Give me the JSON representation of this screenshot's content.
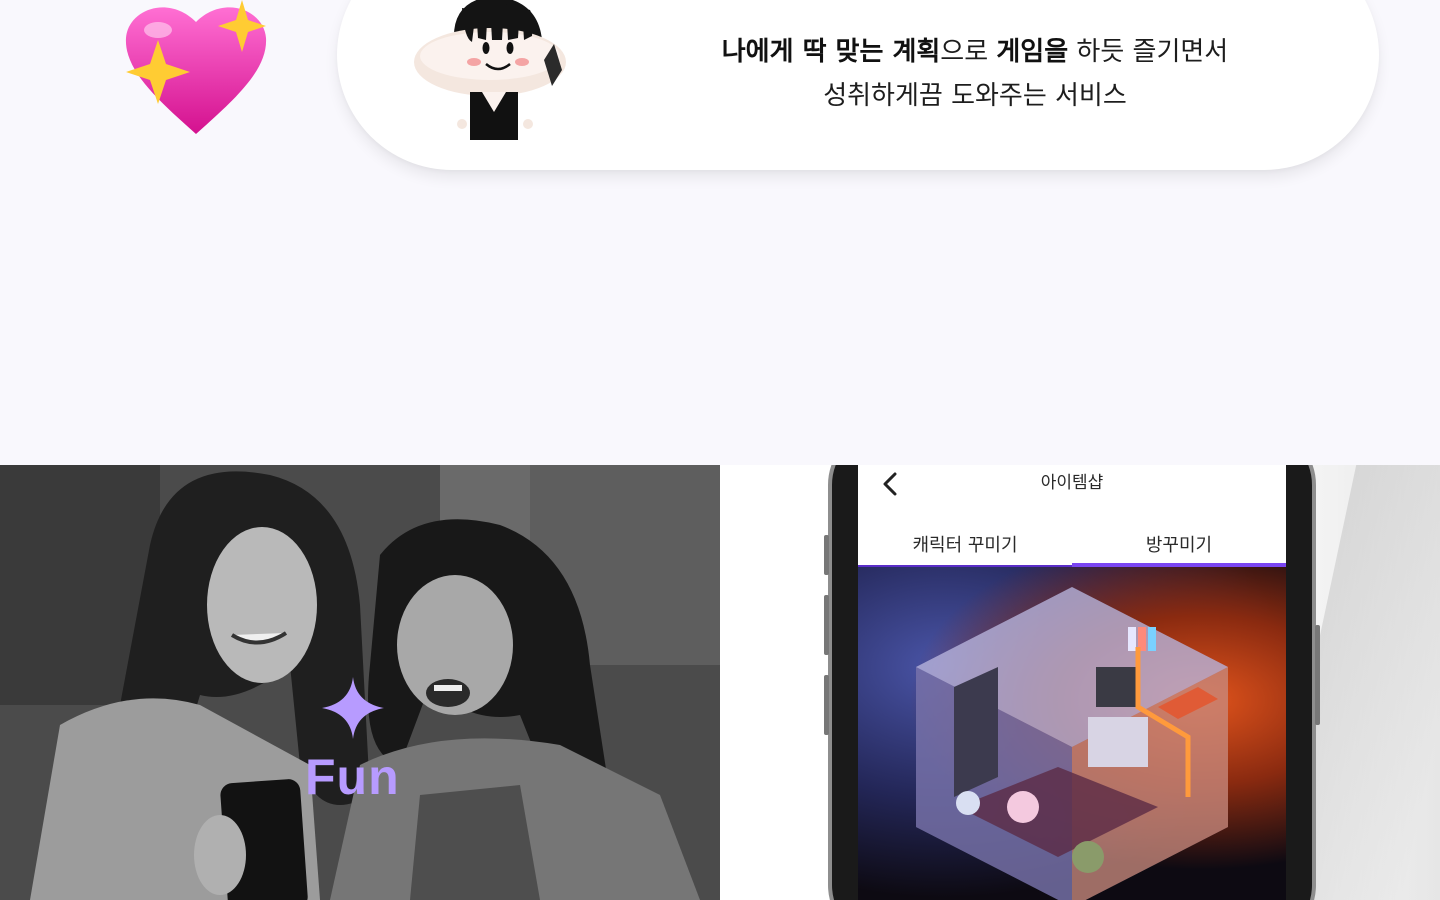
{
  "intro": {
    "text_bold_1": "나에게 딱 맞는 계획",
    "text_plain_1": "으로 ",
    "text_bold_2": "게임을",
    "text_plain_2": " 하듯 즐기면서",
    "line_2": "성취하게끔 도와주는 서비스"
  },
  "feature": {
    "label": "Fun"
  },
  "app": {
    "title": "아이템샵",
    "tabs": [
      {
        "label": "캐릭터 꾸미기",
        "active": false
      },
      {
        "label": "방꾸미기",
        "active": true
      }
    ]
  },
  "colors": {
    "accent": "#b79bff",
    "tab_active": "#7a45f2",
    "background": "#f9f8fd"
  },
  "icons": {
    "heart": "sparkling-heart-icon",
    "back": "chevron-left-icon",
    "feature": "four-point-star-icon"
  }
}
